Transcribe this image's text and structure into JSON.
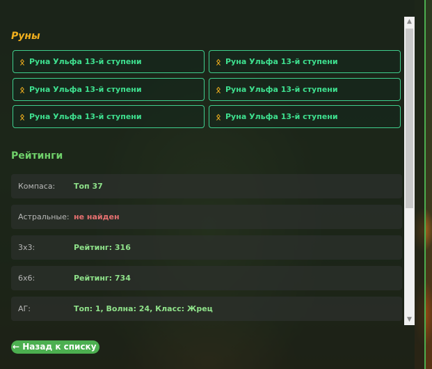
{
  "runes": {
    "title": "Руны",
    "icon": "rune-icon",
    "items": [
      {
        "glyph": "ᛟ",
        "label": "Руна Ульфа 13-й ступени"
      },
      {
        "glyph": "ᛟ",
        "label": "Руна Ульфа 13-й ступени"
      },
      {
        "glyph": "ᛟ",
        "label": "Руна Ульфа 13-й ступени"
      },
      {
        "glyph": "ᛟ",
        "label": "Руна Ульфа 13-й ступени"
      },
      {
        "glyph": "ᛟ",
        "label": "Руна Ульфа 13-й ступени"
      },
      {
        "glyph": "ᛟ",
        "label": "Руна Ульфа 13-й ступени"
      }
    ]
  },
  "ratings": {
    "title": "Рейтинги",
    "rows": [
      {
        "label": "Компаса:",
        "value": "Топ 37"
      },
      {
        "label": "Астральные:",
        "value": "не найден"
      },
      {
        "label": "3x3:",
        "value": "Рейтинг: 316"
      },
      {
        "label": "6x6:",
        "value": "Рейтинг: 734"
      },
      {
        "label": "АГ:",
        "value": "Топ: 1, Волна: 24, Класс: Жрец"
      }
    ]
  },
  "scrollbar": {
    "up": "▲",
    "down": "▼"
  },
  "back_button": {
    "label": "← Назад к списку"
  },
  "colors": {
    "accent": "#4caf50",
    "rune_text": "#3ee08f",
    "runes_title": "#f2b01e",
    "ratings_title": "#6fd06a",
    "value_ok": "#8fe28a",
    "value_bad": "#e67070"
  }
}
